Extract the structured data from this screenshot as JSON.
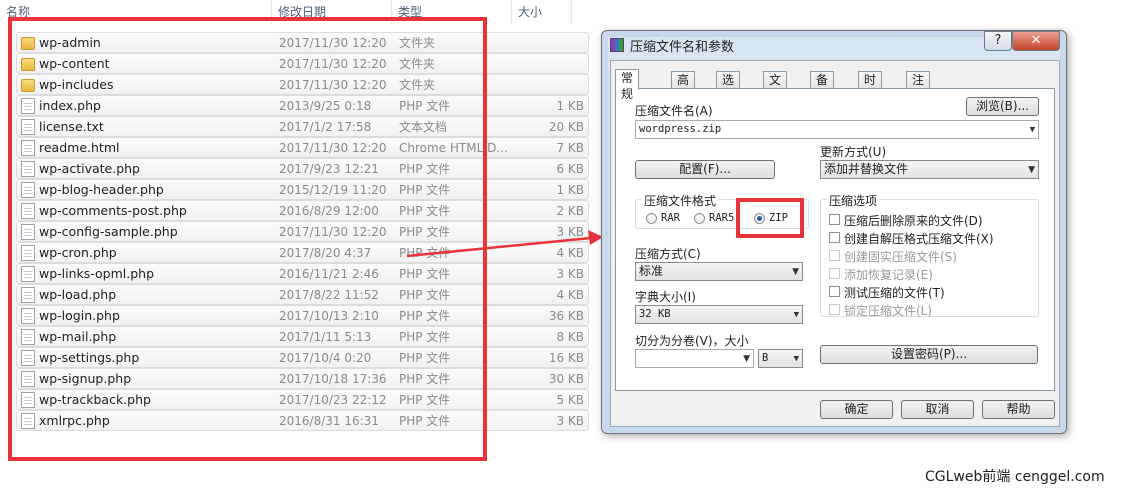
{
  "explorer": {
    "columns": {
      "name": "名称",
      "date": "修改日期",
      "type": "类型",
      "size": "大小"
    },
    "files": [
      {
        "name": "wp-admin",
        "date": "2017/11/30 12:20",
        "type": "文件夹",
        "size": "",
        "icon": "folder-icon"
      },
      {
        "name": "wp-content",
        "date": "2017/11/30 12:20",
        "type": "文件夹",
        "size": "",
        "icon": "folder-icon"
      },
      {
        "name": "wp-includes",
        "date": "2017/11/30 12:20",
        "type": "文件夹",
        "size": "",
        "icon": "folder-icon"
      },
      {
        "name": "index.php",
        "date": "2013/9/25 0:18",
        "type": "PHP 文件",
        "size": "1 KB",
        "icon": "file-icon"
      },
      {
        "name": "license.txt",
        "date": "2017/1/2 17:58",
        "type": "文本文档",
        "size": "20 KB",
        "icon": "file-icon"
      },
      {
        "name": "readme.html",
        "date": "2017/11/30 12:20",
        "type": "Chrome HTML D...",
        "size": "7 KB",
        "icon": "file-icon"
      },
      {
        "name": "wp-activate.php",
        "date": "2017/9/23 12:21",
        "type": "PHP 文件",
        "size": "6 KB",
        "icon": "file-icon"
      },
      {
        "name": "wp-blog-header.php",
        "date": "2015/12/19 11:20",
        "type": "PHP 文件",
        "size": "1 KB",
        "icon": "file-icon"
      },
      {
        "name": "wp-comments-post.php",
        "date": "2016/8/29 12:00",
        "type": "PHP 文件",
        "size": "2 KB",
        "icon": "file-icon"
      },
      {
        "name": "wp-config-sample.php",
        "date": "2017/11/30 12:20",
        "type": "PHP 文件",
        "size": "3 KB",
        "icon": "file-icon"
      },
      {
        "name": "wp-cron.php",
        "date": "2017/8/20 4:37",
        "type": "PHP 文件",
        "size": "4 KB",
        "icon": "file-icon"
      },
      {
        "name": "wp-links-opml.php",
        "date": "2016/11/21 2:46",
        "type": "PHP 文件",
        "size": "3 KB",
        "icon": "file-icon"
      },
      {
        "name": "wp-load.php",
        "date": "2017/8/22 11:52",
        "type": "PHP 文件",
        "size": "4 KB",
        "icon": "file-icon"
      },
      {
        "name": "wp-login.php",
        "date": "2017/10/13 2:10",
        "type": "PHP 文件",
        "size": "36 KB",
        "icon": "file-icon"
      },
      {
        "name": "wp-mail.php",
        "date": "2017/1/11 5:13",
        "type": "PHP 文件",
        "size": "8 KB",
        "icon": "file-icon"
      },
      {
        "name": "wp-settings.php",
        "date": "2017/10/4 0:20",
        "type": "PHP 文件",
        "size": "16 KB",
        "icon": "file-icon"
      },
      {
        "name": "wp-signup.php",
        "date": "2017/10/18 17:36",
        "type": "PHP 文件",
        "size": "30 KB",
        "icon": "file-icon"
      },
      {
        "name": "wp-trackback.php",
        "date": "2017/10/23 22:12",
        "type": "PHP 文件",
        "size": "5 KB",
        "icon": "file-icon"
      },
      {
        "name": "xmlrpc.php",
        "date": "2016/8/31 16:31",
        "type": "PHP 文件",
        "size": "3 KB",
        "icon": "file-icon"
      }
    ]
  },
  "dialog": {
    "title": "压缩文件名和参数",
    "help_label": "?",
    "close_label": "✕",
    "tabs": [
      "常规",
      "高级",
      "选项",
      "文件",
      "备份",
      "时间",
      "注释"
    ],
    "archive_name_label": "压缩文件名(A)",
    "browse_label": "浏览(B)...",
    "archive_name_value": "wordpress.zip",
    "update_mode_label": "更新方式(U)",
    "update_mode_value": "添加并替换文件",
    "profiles_label": "配置(F)...",
    "format_group_label": "压缩文件格式",
    "formats": [
      {
        "label": "RAR",
        "selected": false
      },
      {
        "label": "RAR5",
        "selected": false
      },
      {
        "label": "ZIP",
        "selected": true
      }
    ],
    "method_label": "压缩方式(C)",
    "method_value": "标准",
    "dict_label": "字典大小(I)",
    "dict_value": "32 KB",
    "split_label": "切分为分卷(V)，大小",
    "split_value": "",
    "split_unit": "B",
    "options_group_label": "压缩选项",
    "options": [
      {
        "label": "压缩后删除原来的文件(D)",
        "enabled": true,
        "checked": false
      },
      {
        "label": "创建自解压格式压缩文件(X)",
        "enabled": true,
        "checked": false
      },
      {
        "label": "创建固实压缩文件(S)",
        "enabled": false,
        "checked": false
      },
      {
        "label": "添加恢复记录(E)",
        "enabled": false,
        "checked": false
      },
      {
        "label": "测试压缩的文件(T)",
        "enabled": true,
        "checked": false
      },
      {
        "label": "锁定压缩文件(L)",
        "enabled": false,
        "checked": false
      }
    ],
    "password_label": "设置密码(P)...",
    "ok_label": "确定",
    "cancel_label": "取消",
    "help_button_label": "帮助"
  },
  "colors": {
    "highlight_red": "#e8333a",
    "dialog_frame": "#c9d9ec"
  },
  "watermark": "CGLweb前端 cenggel.com"
}
